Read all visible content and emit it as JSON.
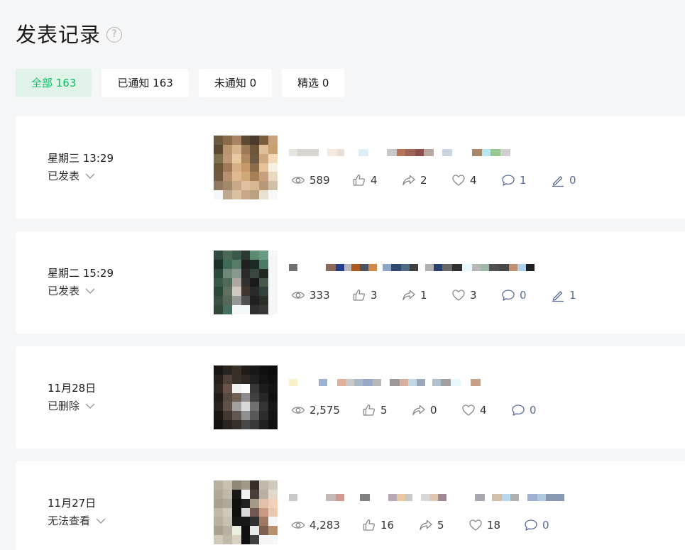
{
  "page": {
    "title": "发表记录",
    "help_icon": "question-circle-icon"
  },
  "tabs": [
    {
      "label": "全部 163",
      "active": true
    },
    {
      "label": "已通知 163",
      "active": false
    },
    {
      "label": "未通知 0",
      "active": false
    },
    {
      "label": "精选 0",
      "active": false
    }
  ],
  "colors": {
    "accent_green": "#07c160",
    "active_tab_bg": "#e1f3e9",
    "link_blue": "#576b95",
    "page_bg": "#f5f6f7"
  },
  "posts": [
    {
      "date": "星期三 13:29",
      "status": "已发表",
      "stats": {
        "views": "589",
        "likes": "4",
        "shares": "2",
        "favorites": "4",
        "comments": "1",
        "edits": "0"
      }
    },
    {
      "date": "星期二 15:29",
      "status": "已发表",
      "stats": {
        "views": "333",
        "likes": "3",
        "shares": "1",
        "favorites": "3",
        "comments": "0",
        "edits": "1"
      }
    },
    {
      "date": "11月28日",
      "status": "已删除",
      "stats": {
        "views": "2,575",
        "likes": "5",
        "shares": "0",
        "favorites": "4",
        "comments": "0"
      }
    },
    {
      "date": "11月27日",
      "status": "无法查看",
      "stats": {
        "views": "4,283",
        "likes": "16",
        "shares": "5",
        "favorites": "18",
        "comments": "0"
      }
    }
  ]
}
